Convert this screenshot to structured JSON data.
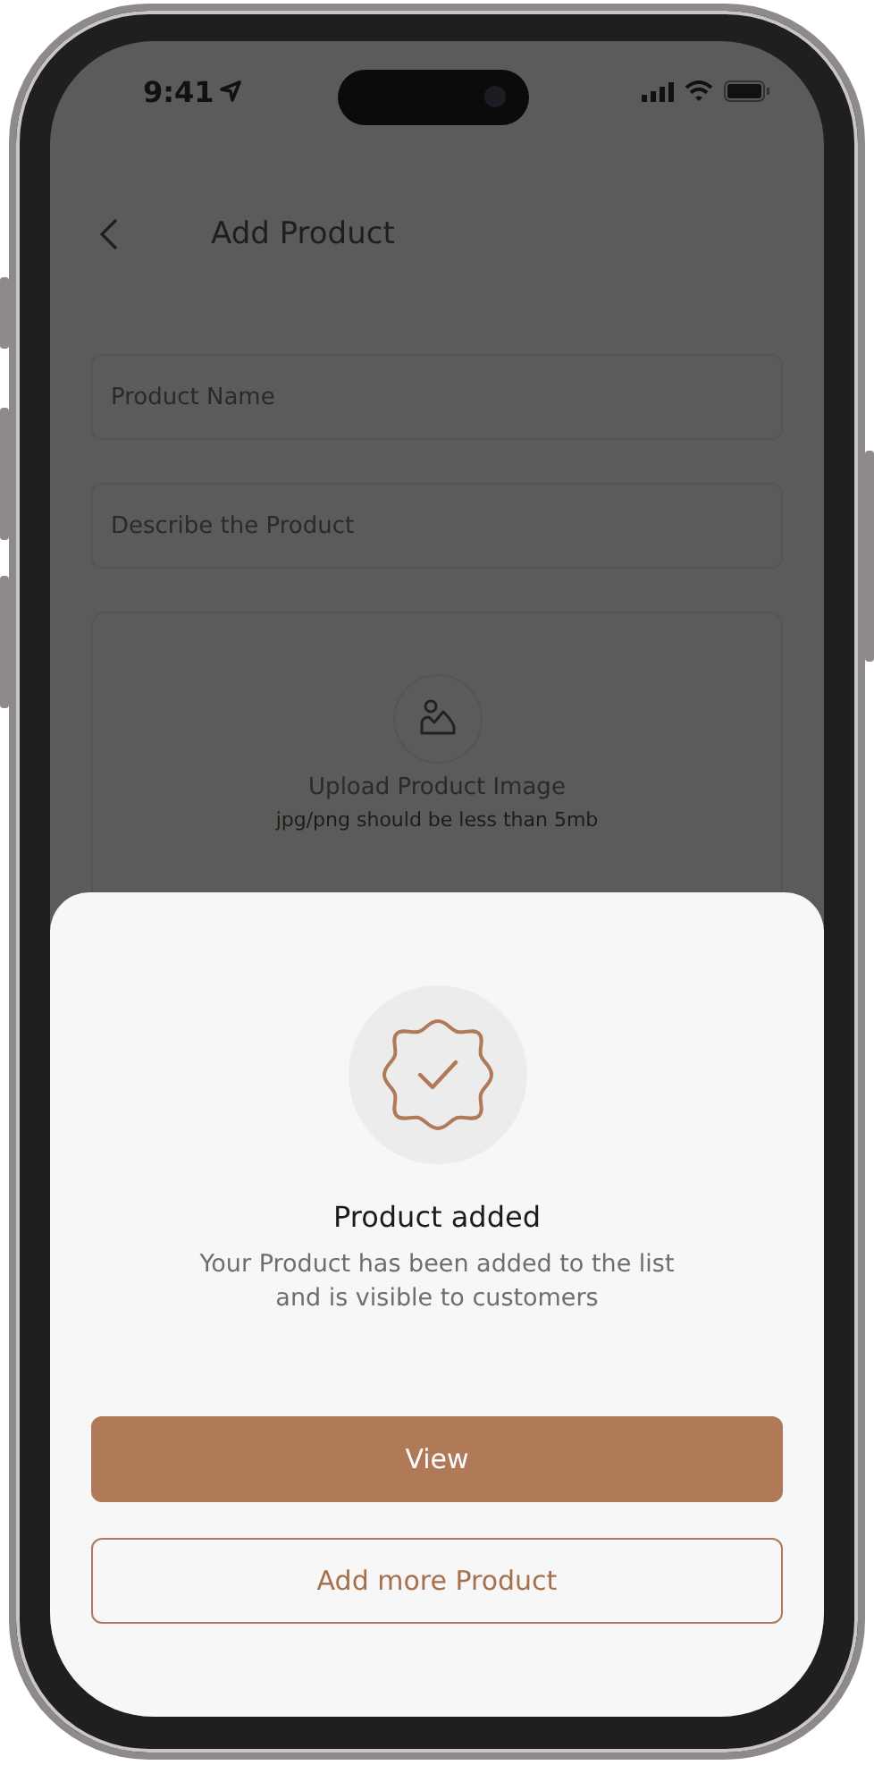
{
  "status_bar": {
    "time": "9:41"
  },
  "header": {
    "title": "Add Product"
  },
  "form": {
    "fields": [
      {
        "placeholder": "Product Name"
      },
      {
        "placeholder": "Describe the Product"
      }
    ],
    "upload": {
      "title": "Upload Product Image",
      "hint": "jpg/png should be less than 5mb"
    }
  },
  "dialog": {
    "title": "Product added",
    "message": "Your Product has been added to the list and is visible to customers",
    "buttons": [
      {
        "label": "View",
        "kind": "primary"
      },
      {
        "label": "Add more Product",
        "kind": "outline"
      }
    ]
  }
}
